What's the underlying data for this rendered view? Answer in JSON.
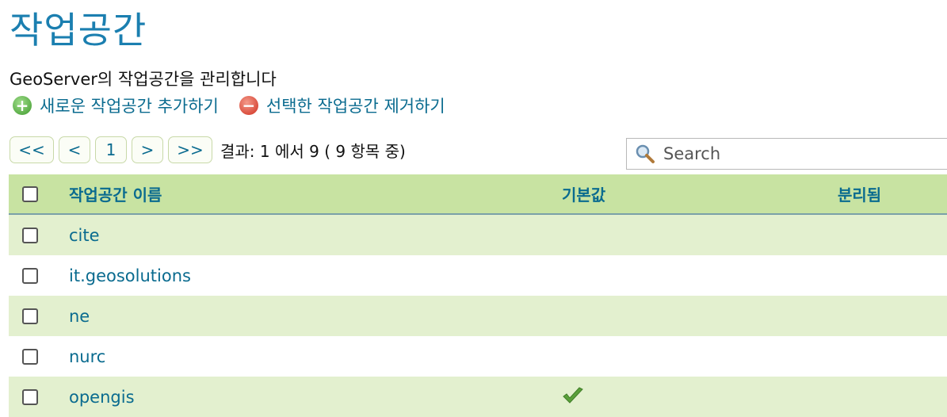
{
  "page": {
    "title": "작업공간",
    "description": "GeoServer의 작업공간을 관리합니다"
  },
  "actions": {
    "add_label": "새로운 작업공간 추가하기",
    "remove_label": "선택한 작업공간 제거하기"
  },
  "pager": {
    "first": "<<",
    "prev": "<",
    "page": "1",
    "next": ">",
    "last": ">>",
    "info": "결과: 1 에서 9 ( 9 항목 중)"
  },
  "search": {
    "placeholder": "Search"
  },
  "table": {
    "headers": {
      "name": "작업공간 이름",
      "default": "기본값",
      "isolated": "분리됨"
    },
    "rows": [
      {
        "name": "cite",
        "default": false
      },
      {
        "name": "it.geosolutions",
        "default": false
      },
      {
        "name": "ne",
        "default": false
      },
      {
        "name": "nurc",
        "default": false
      },
      {
        "name": "opengis",
        "default": true
      }
    ]
  },
  "icons": {
    "add": "add-circle-icon",
    "remove": "remove-circle-icon",
    "search": "magnifier-icon",
    "check": "checkmark-icon"
  },
  "colors": {
    "accent": "#1b7fb0",
    "header_bg": "#c8e3a2",
    "alt_row": "#e3f0cf"
  }
}
